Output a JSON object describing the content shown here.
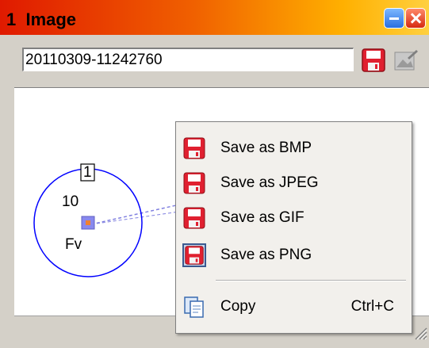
{
  "window": {
    "title": "1  Image",
    "minimize_icon": "minimize-icon",
    "close_icon": "close-icon"
  },
  "toolbar": {
    "filename_value": "20110309-11242760",
    "save_icon": "floppy-save-icon",
    "image_icon": "image-edit-icon"
  },
  "diagram": {
    "node": {
      "id_label": "1",
      "value_label": "10",
      "type_label": "Fv"
    },
    "colors": {
      "circle": "#0000ff",
      "center_point": "#f08030",
      "link": "#8080e0"
    }
  },
  "context_menu": {
    "items": [
      {
        "label": "Save as BMP",
        "icon": "floppy-save-icon"
      },
      {
        "label": "Save as JPEG",
        "icon": "floppy-save-icon"
      },
      {
        "label": "Save as GIF",
        "icon": "floppy-save-icon"
      },
      {
        "label": "Save as PNG",
        "icon": "floppy-save-icon",
        "checked": true
      },
      {
        "label": "Copy",
        "icon": "copy-icon",
        "shortcut": "Ctrl+C"
      }
    ]
  }
}
